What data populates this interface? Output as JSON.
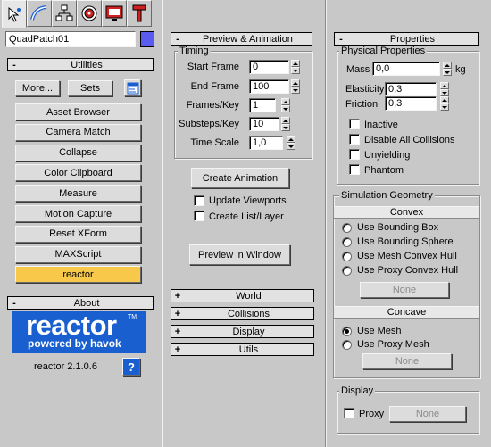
{
  "top": {
    "object_name": "QuadPatch01",
    "color_swatch": "#5a5cf0",
    "tabs": [
      "create-tab",
      "modify-tab",
      "hierarchy-tab",
      "motion-tab",
      "display-tab",
      "utilities-tab"
    ]
  },
  "utilities": {
    "title": "Utilities",
    "sign": "-",
    "more_label": "More...",
    "sets_label": "Sets",
    "items": [
      "Asset Browser",
      "Camera Match",
      "Collapse",
      "Color Clipboard",
      "Measure",
      "Motion Capture",
      "Reset XForm",
      "MAXScript",
      "reactor"
    ],
    "active_color": "#f7c84a"
  },
  "about": {
    "title": "About",
    "sign": "-",
    "logo_main": "reactor",
    "logo_tm": "TM",
    "logo_sub": "powered by havok",
    "version": "reactor 2.1.0.6",
    "help_label": "?",
    "logo_color": "#1a5fcf"
  },
  "preview": {
    "title": "Preview & Animation",
    "sign": "-",
    "timing_label": "Timing",
    "start_frame_label": "Start Frame",
    "start_frame": "0",
    "end_frame_label": "End Frame",
    "end_frame": "100",
    "frames_key_label": "Frames/Key",
    "frames_key": "1",
    "substeps_label": "Substeps/Key",
    "substeps": "10",
    "time_scale_label": "Time Scale",
    "time_scale": "1,0",
    "create_animation": "Create Animation",
    "update_viewports": "Update Viewports",
    "create_list_layer": "Create List/Layer",
    "preview_window": "Preview in Window"
  },
  "collapsed": [
    {
      "sign": "+",
      "title": "World"
    },
    {
      "sign": "+",
      "title": "Collisions"
    },
    {
      "sign": "+",
      "title": "Display"
    },
    {
      "sign": "+",
      "title": "Utils"
    }
  ],
  "properties": {
    "title": "Properties",
    "sign": "-",
    "physical_label": "Physical Properties",
    "mass_label": "Mass",
    "mass": "0,0",
    "mass_unit": "kg",
    "elasticity_label": "Elasticity",
    "elasticity": "0,3",
    "friction_label": "Friction",
    "friction": "0,3",
    "checkboxes": [
      "Inactive",
      "Disable All Collisions",
      "Unyielding",
      "Phantom"
    ],
    "sim_geom_label": "Simulation Geometry",
    "convex_label": "Convex",
    "convex_options": [
      "Use Bounding Box",
      "Use Bounding Sphere",
      "Use Mesh Convex Hull",
      "Use Proxy Convex Hull"
    ],
    "convex_none": "None",
    "concave_label": "Concave",
    "concave_options": [
      "Use Mesh",
      "Use Proxy Mesh"
    ],
    "concave_selected": "Use Mesh",
    "concave_none": "None",
    "display_label": "Display",
    "proxy_label": "Proxy",
    "proxy_none": "None"
  }
}
